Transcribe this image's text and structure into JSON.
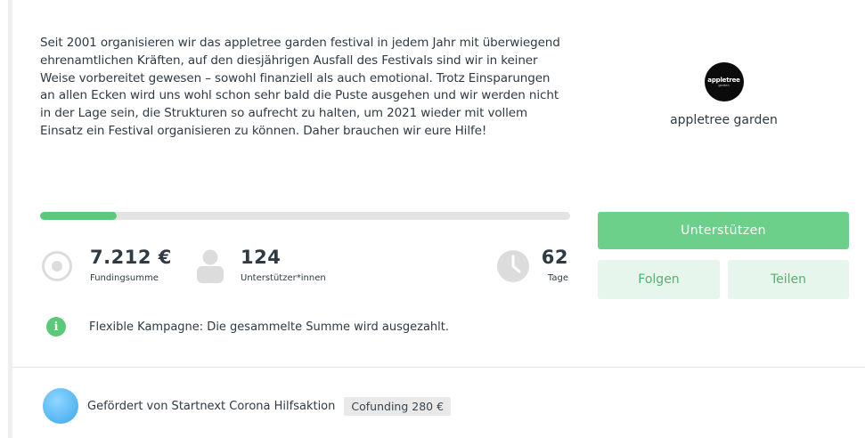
{
  "description": "Seit 2001 organisieren wir das appletree garden festival in jedem Jahr mit überwiegend ehrenamtlichen Kräften, auf den diesjährigen Ausfall des Festivals sind wir in keiner Weise vorbereitet gewesen – sowohl finanziell als auch emotional. Trotz Einsparungen an allen Ecken wird uns wohl schon sehr bald die Puste ausgehen und wir werden nicht in der Lage sein, die Strukturen so aufrecht zu halten, um 2021 wieder mit vollem Einsatz ein Festival organisieren zu können. Daher brauchen wir eure Hilfe!",
  "project": {
    "logo_text": "appletree",
    "logo_subtext": "garden",
    "name": "appletree garden"
  },
  "progress": {
    "fraction": 0.145,
    "fill_color": "#5cc87a"
  },
  "stats": {
    "funding": {
      "value": "7.212 €",
      "label": "Fundingsumme",
      "icon": "target-icon"
    },
    "supporters": {
      "value": "124",
      "label": "Unterstützer*innen",
      "icon": "person-icon"
    },
    "days": {
      "value": "62",
      "label": "Tage",
      "icon": "clock-icon"
    }
  },
  "actions": {
    "support_label": "Unterstützen",
    "follow_label": "Folgen",
    "share_label": "Teilen"
  },
  "info": {
    "icon": "info-icon",
    "text": "Flexible Kampagne: Die gesammelte Summe wird ausgezahlt."
  },
  "sponsor": {
    "text": "Gefördert von Startnext Corona Hilfsaktion",
    "tag": "Cofunding 280 €"
  },
  "colors": {
    "accent": "#6dd08a",
    "accent_light": "#e7f6ec",
    "text": "#2e3a44"
  }
}
